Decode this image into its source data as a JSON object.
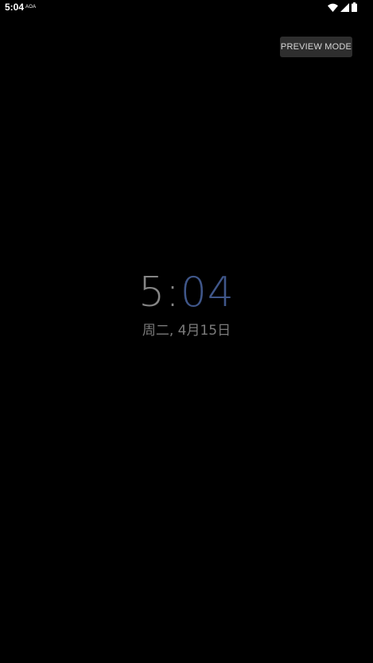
{
  "status_bar": {
    "time": "5:04",
    "app_badge": "AOA",
    "icons": [
      "wifi-icon",
      "signal-icon",
      "battery-icon"
    ]
  },
  "preview_button": {
    "label": "PREVIEW MODE"
  },
  "clock": {
    "hours": "5",
    "separator": ":",
    "minutes": "04",
    "hours_color": "#858585",
    "minutes_color": "#3f5689"
  },
  "date": {
    "text": "周二, 4月15日"
  }
}
